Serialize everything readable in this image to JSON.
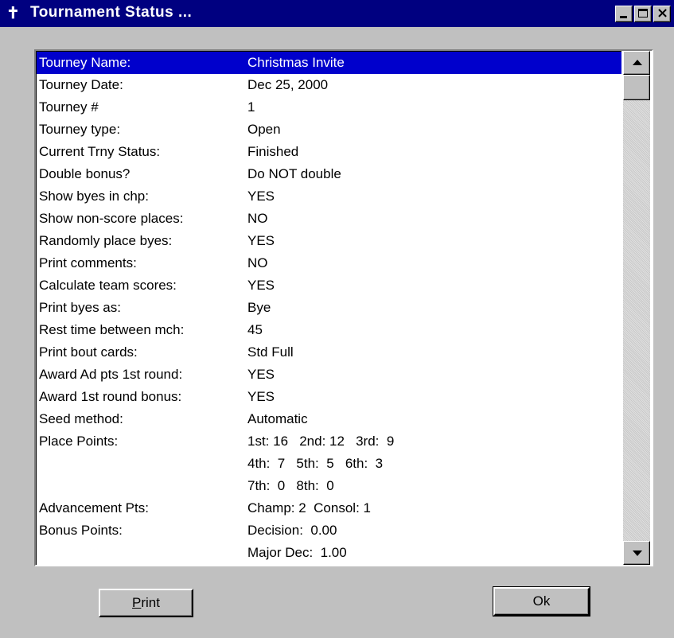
{
  "window": {
    "title": "Tournament Status ...",
    "app_icon": "✝",
    "close_glyph": "×"
  },
  "rows": [
    {
      "label": "Tourney Name:",
      "value": "Christmas Invite",
      "selected": true
    },
    {
      "label": "Tourney Date:",
      "value": "Dec 25, 2000"
    },
    {
      "label": "Tourney #",
      "value": "1"
    },
    {
      "label": "Tourney type:",
      "value": "Open"
    },
    {
      "label": "Current Trny Status:",
      "value": "Finished"
    },
    {
      "label": "Double bonus?",
      "value": "Do NOT double"
    },
    {
      "label": "Show byes in chp:",
      "value": "YES"
    },
    {
      "label": "Show non-score places:",
      "value": "NO"
    },
    {
      "label": "Randomly place byes:",
      "value": "YES"
    },
    {
      "label": "Print comments:",
      "value": "NO"
    },
    {
      "label": "Calculate team scores:",
      "value": "YES"
    },
    {
      "label": "Print byes as:",
      "value": "Bye"
    },
    {
      "label": "Rest time between mch:",
      "value": "45"
    },
    {
      "label": "Print bout cards:",
      "value": "Std Full"
    },
    {
      "label": "Award Ad pts 1st round:",
      "value": "YES"
    },
    {
      "label": "Award 1st round bonus:",
      "value": "YES"
    },
    {
      "label": "Seed method:",
      "value": "Automatic"
    },
    {
      "label": "Place Points:",
      "value": "1st: 16   2nd: 12   3rd:  9"
    },
    {
      "label": "",
      "value": "4th:  7   5th:  5   6th:  3"
    },
    {
      "label": "",
      "value": "7th:  0   8th:  0"
    },
    {
      "label": "Advancement Pts:",
      "value": "Champ: 2  Consol: 1"
    },
    {
      "label": "Bonus Points:",
      "value": "Decision:  0.00"
    },
    {
      "label": "",
      "value": "Major Dec:  1.00"
    }
  ],
  "buttons": {
    "print_mnemonic": "P",
    "print_rest": "rint",
    "ok": "Ok"
  },
  "colors": {
    "titlebar": "#000080",
    "selection": "#0000cc",
    "face": "#c0c0c0"
  }
}
